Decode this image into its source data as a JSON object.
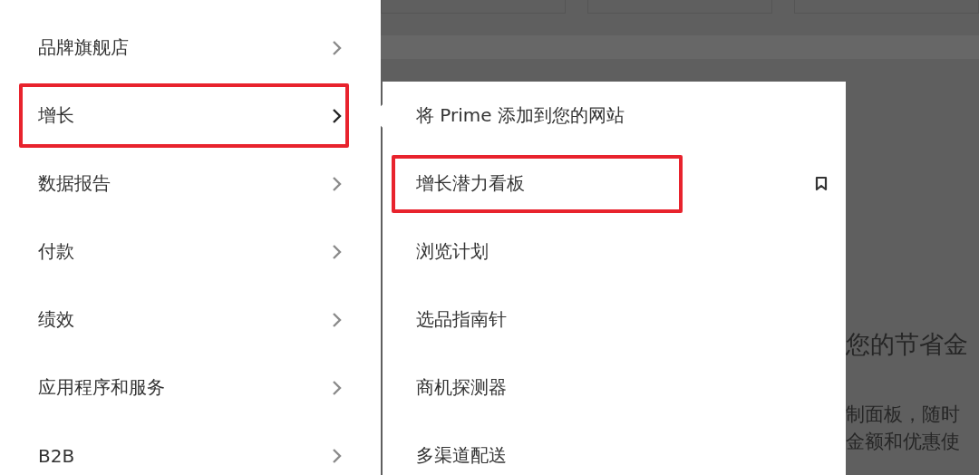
{
  "menu": {
    "items": [
      {
        "label": "品牌旗舰店",
        "expanded": false,
        "highlighted": false
      },
      {
        "label": "增长",
        "expanded": true,
        "highlighted": true
      },
      {
        "label": "数据报告",
        "expanded": false,
        "highlighted": false
      },
      {
        "label": "付款",
        "expanded": false,
        "highlighted": false
      },
      {
        "label": "绩效",
        "expanded": false,
        "highlighted": false
      },
      {
        "label": "应用程序和服务",
        "expanded": false,
        "highlighted": false
      },
      {
        "label": "B2B",
        "expanded": false,
        "highlighted": false
      }
    ]
  },
  "submenu": {
    "items": [
      {
        "label": "将 Prime 添加到您的网站",
        "highlighted": false,
        "bookmark": false
      },
      {
        "label": "增长潜力看板",
        "highlighted": true,
        "bookmark": true
      },
      {
        "label": "浏览计划",
        "highlighted": false,
        "bookmark": false
      },
      {
        "label": "选品指南针",
        "highlighted": false,
        "bookmark": false
      },
      {
        "label": "商机探测器",
        "highlighted": false,
        "bookmark": false
      },
      {
        "label": "多渠道配送",
        "highlighted": false,
        "bookmark": false
      }
    ]
  },
  "background": {
    "heading": "您的节省金",
    "lines": [
      "制面板，随时",
      "金额和优惠使"
    ]
  }
}
